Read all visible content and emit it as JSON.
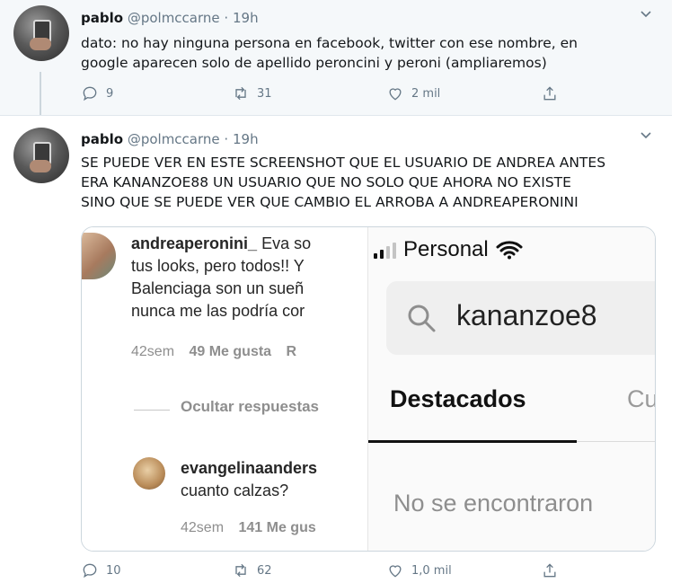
{
  "tweets": [
    {
      "name": "pablo",
      "handle": "@polmccarne",
      "dot": "·",
      "time": "19h",
      "text_lines": [
        "dato: no hay ninguna persona en facebook, twitter con ese nombre, en",
        "google aparecen solo de apellido peroncini y peroni (ampliaremos)"
      ],
      "replies": "9",
      "retweets": "31",
      "likes": "2 mil"
    },
    {
      "name": "pablo",
      "handle": "@polmccarne",
      "dot": "·",
      "time": "19h",
      "text_lines": [
        "SE PUEDE VER EN ESTE SCREENSHOT QUE EL USUARIO DE ANDREA ANTES",
        "ERA KANANZOE88 UN USUARIO QUE NO SOLO QUE AHORA NO EXISTE",
        "SINO QUE SE PUEDE VER QUE CAMBIO EL ARROBA A ANDREAPERONINI"
      ],
      "replies": "10",
      "retweets": "62",
      "likes": "1,0 mil"
    }
  ],
  "instagram": {
    "comment1_user": "andreaperonini_",
    "comment1_lines": [
      "Eva so",
      "tus looks, pero todos!! Y",
      "Balenciaga son un sueñ",
      "nunca me las podría cor"
    ],
    "comment1_age": "42sem",
    "comment1_likes": "49 Me gusta",
    "comment1_reply": "R",
    "hide_replies": "Ocultar respuestas",
    "comment2_user": "evangelinaanders",
    "comment2_text": "cuanto calzas?",
    "comment2_age": "42sem",
    "comment2_likes": "141 Me gus"
  },
  "phone": {
    "carrier": "Personal",
    "search_text": "kananzoe8",
    "tab_active": "Destacados",
    "tab_other": "Cu",
    "no_results": "No se encontraron"
  },
  "colors": {
    "accent": "#1da1f2",
    "muted": "#657786",
    "tweet_bg_hover": "#f5f8fa"
  },
  "icons": [
    "reply-icon",
    "retweet-icon",
    "like-icon",
    "share-icon",
    "chevron-down-icon",
    "search-icon",
    "wifi-icon",
    "signal-icon"
  ]
}
